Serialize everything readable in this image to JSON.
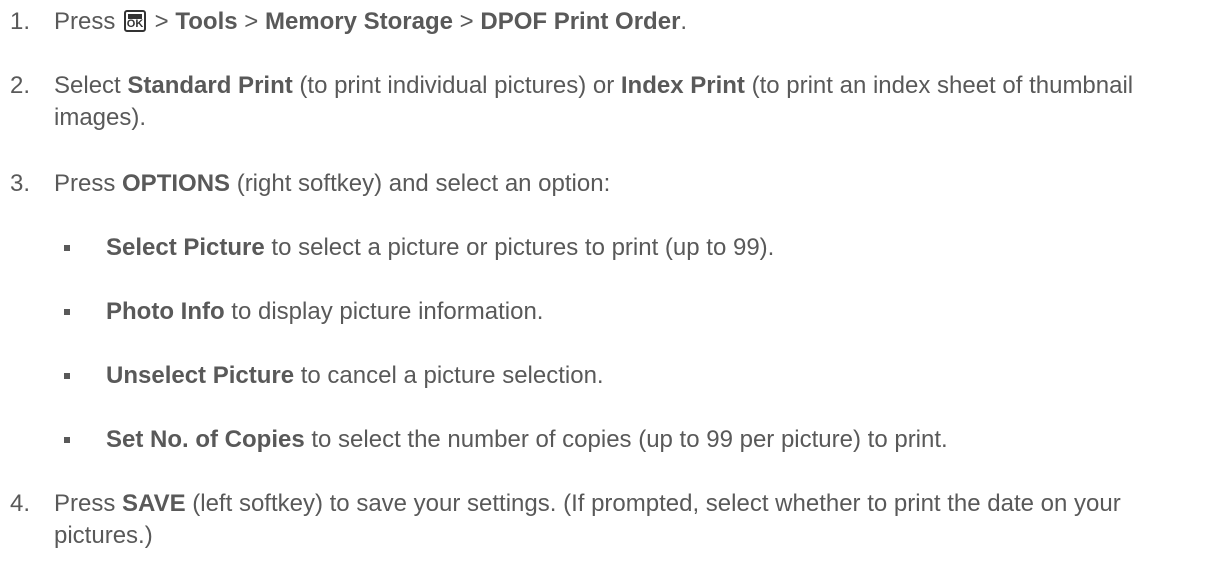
{
  "steps": [
    {
      "num": "1.",
      "t1": "Press ",
      "icon": "menu-ok-key-icon",
      "icon_text": "OK",
      "t2": " > ",
      "b1": "Tools",
      "t3": " > ",
      "b2": "Memory Storage",
      "t4": " > ",
      "b3": "DPOF Print Order",
      "t5": "."
    },
    {
      "num": "2.",
      "t1": "Select ",
      "b1": "Standard Print",
      "t2": " (to print individual pictures) or ",
      "b2": "Index Print",
      "t3": " (to print an index sheet of thumbnail images)."
    },
    {
      "num": "3.",
      "t1": "Press ",
      "b1": "OPTIONS",
      "t2": " (right softkey) and select an option:"
    },
    {
      "num": "4.",
      "t1": "Press ",
      "b1": "SAVE",
      "t2": " (left softkey) to save your settings. (If prompted, select whether to print the date on your pictures.)"
    }
  ],
  "options": [
    {
      "b": "Select Picture",
      "t": " to select a picture or pictures to print (up to 99)."
    },
    {
      "b": "Photo Info",
      "t": " to display picture information."
    },
    {
      "b": "Unselect Picture",
      "t": " to cancel a picture selection."
    },
    {
      "b": "Set No. of Copies",
      "t": " to select the number of copies (up to 99 per picture) to print."
    }
  ]
}
